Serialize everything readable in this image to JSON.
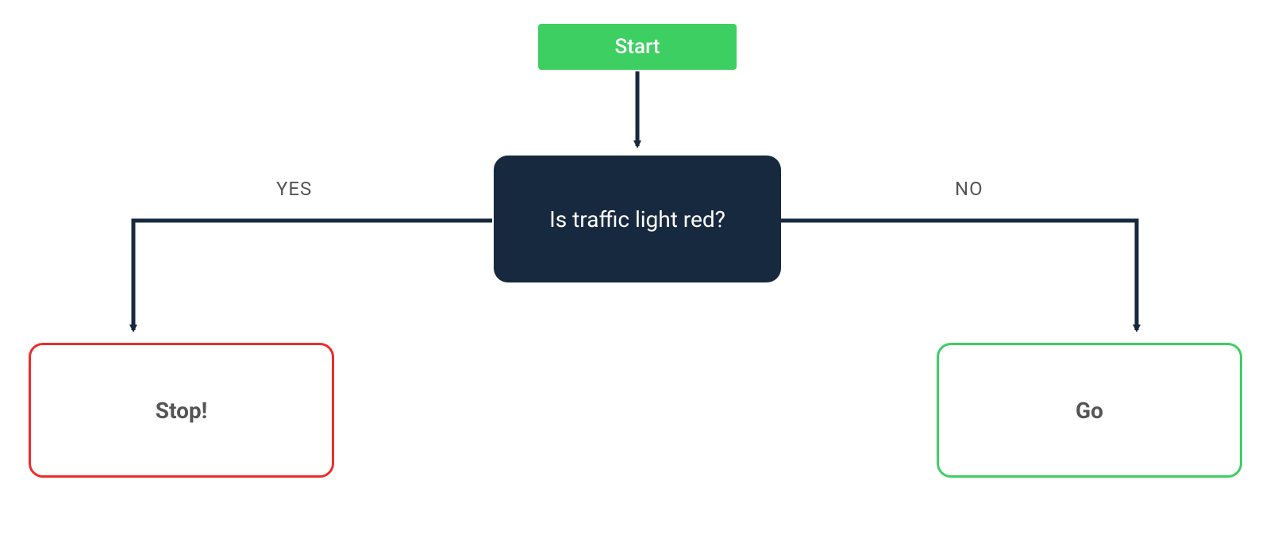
{
  "flowchart": {
    "start": {
      "label": "Start"
    },
    "decision": {
      "label": "Is traffic light red?"
    },
    "edges": {
      "yes": {
        "label": "YES"
      },
      "no": {
        "label": "NO"
      }
    },
    "stop": {
      "label": "Stop!"
    },
    "go": {
      "label": "Go"
    }
  },
  "colors": {
    "start_bg": "#3ecf63",
    "decision_bg": "#17293e",
    "stop_border": "#ef2b2b",
    "go_border": "#3ecf63",
    "connector": "#17293e",
    "edge_label": "#555555"
  }
}
